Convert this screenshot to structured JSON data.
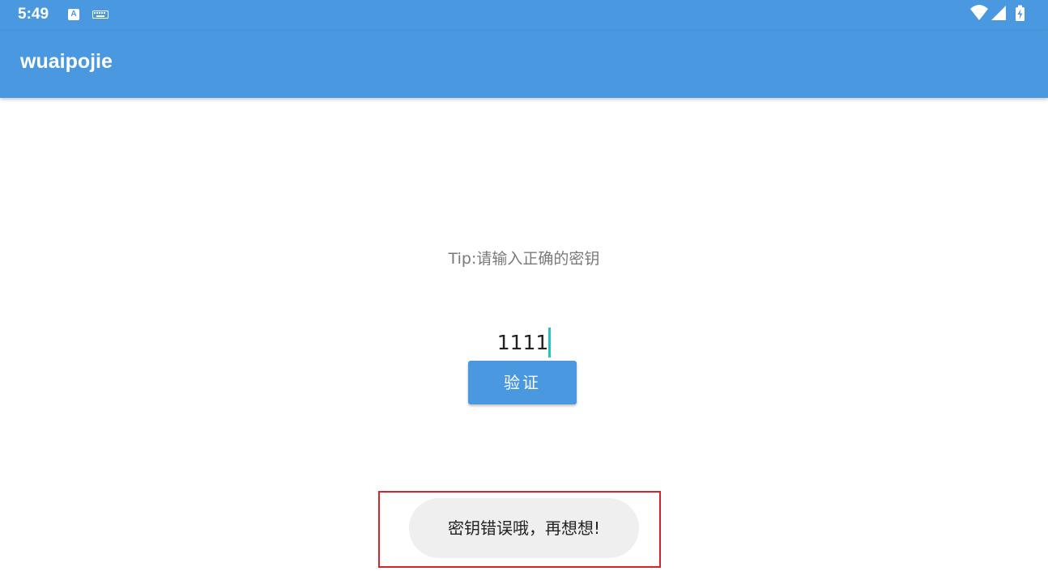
{
  "status_bar": {
    "time": "5:49",
    "notification_icon_letter": "A",
    "icons": [
      "a-notification-icon",
      "keyboard-icon",
      "wifi-icon",
      "signal-icon",
      "battery-charging-icon"
    ]
  },
  "app_bar": {
    "title": "wuaipojie"
  },
  "main": {
    "tip": "Tip:请输入正确的密钥",
    "key_input": {
      "value": "1111"
    },
    "verify_button": {
      "label": "验证"
    }
  },
  "toast": {
    "message": "密钥错误哦，再想想!"
  },
  "colors": {
    "primary": "#4a98e0",
    "cursor": "#21c4c4",
    "highlight": "#d8232a",
    "toast_bg": "#efefef"
  }
}
